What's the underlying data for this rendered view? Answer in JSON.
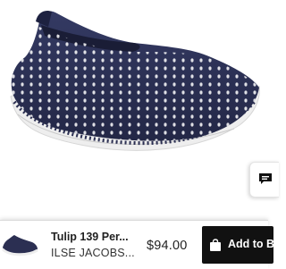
{
  "product": {
    "title": "Tulip 139 Per...",
    "brand": "ILSE JACOBS...",
    "price": "$94.00",
    "image_icon": "slip-on-sneaker-image"
  },
  "actions": {
    "add_to_bag_label": "Add to B",
    "bag_icon": "shopping-bag-icon",
    "chat_icon": "chat-icon"
  },
  "colors": {
    "shoe_upper": "#2b2f52",
    "sole": "#f1f1f1",
    "button_bg": "#111111",
    "button_text": "#ffffff"
  }
}
